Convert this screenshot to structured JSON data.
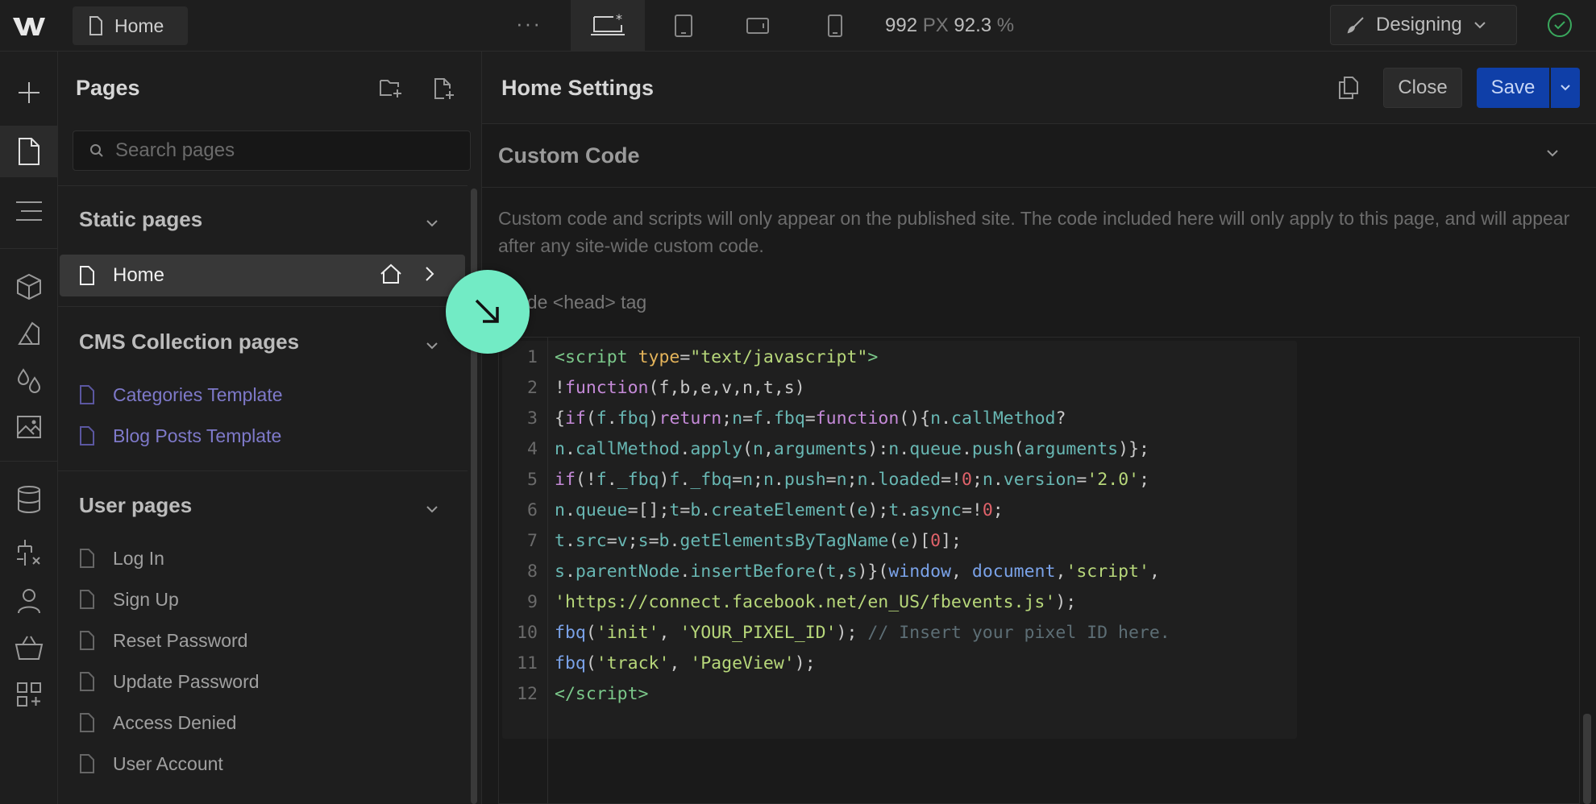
{
  "topbar": {
    "tab_label": "Home",
    "more": "···",
    "canvas_width": "992",
    "canvas_width_unit": "PX",
    "zoom": "92.3",
    "zoom_unit": "%",
    "mode_label": "Designing"
  },
  "pages_panel": {
    "title": "Pages",
    "search_placeholder": "Search pages",
    "static_title": "Static pages",
    "home_label": "Home",
    "cms_title": "CMS Collection pages",
    "cms_items": [
      "Categories Template",
      "Blog Posts Template"
    ],
    "user_title": "User pages",
    "user_items": [
      "Log In",
      "Sign Up",
      "Reset Password",
      "Update Password",
      "Access Denied",
      "User Account"
    ]
  },
  "settings": {
    "title": "Home Settings",
    "close_label": "Close",
    "save_label": "Save",
    "section_title": "Custom Code",
    "description": "Custom code and scripts will only appear on the published site. The code included here will only apply to this page, and will appear after any site-wide custom code.",
    "head_label": "Inside <head> tag",
    "code_lines": [
      {
        "n": "1",
        "html": "<span style=\"color:#7bc88a\">&lt;script</span> <span style=\"color:#e3b35a\">type</span>=<span style=\"color:#b7d77a\">\"text/javascript\"</span><span style=\"color:#7bc88a\">&gt;</span>"
      },
      {
        "n": "2",
        "html": "!<span style=\"color:#c58ad8\">function</span>(f,b,e,v,n,t,s)"
      },
      {
        "n": "3",
        "html": "{<span style=\"color:#c58ad8\">if</span>(<span style=\"color:#68b7b3\">f</span>.<span style=\"color:#68b7b3\">fbq</span>)<span style=\"color:#c58ad8\">return</span>;<span style=\"color:#68b7b3\">n</span>=<span style=\"color:#68b7b3\">f</span>.<span style=\"color:#68b7b3\">fbq</span>=<span style=\"color:#c58ad8\">function</span>(){<span style=\"color:#68b7b3\">n</span>.<span style=\"color:#68b7b3\">callMethod</span>?"
      },
      {
        "n": "4",
        "html": "<span style=\"color:#68b7b3\">n</span>.<span style=\"color:#68b7b3\">callMethod</span>.<span style=\"color:#68b7b3\">apply</span>(<span style=\"color:#68b7b3\">n</span>,<span style=\"color:#68b7b3\">arguments</span>):<span style=\"color:#68b7b3\">n</span>.<span style=\"color:#68b7b3\">queue</span>.<span style=\"color:#68b7b3\">push</span>(<span style=\"color:#68b7b3\">arguments</span>)};"
      },
      {
        "n": "5",
        "html": "<span style=\"color:#c58ad8\">if</span>(!<span style=\"color:#68b7b3\">f</span>.<span style=\"color:#68b7b3\">_fbq</span>)<span style=\"color:#68b7b3\">f</span>.<span style=\"color:#68b7b3\">_fbq</span>=<span style=\"color:#68b7b3\">n</span>;<span style=\"color:#68b7b3\">n</span>.<span style=\"color:#68b7b3\">push</span>=<span style=\"color:#68b7b3\">n</span>;<span style=\"color:#68b7b3\">n</span>.<span style=\"color:#68b7b3\">loaded</span>=!<span style=\"color:#e0626a\">0</span>;<span style=\"color:#68b7b3\">n</span>.<span style=\"color:#68b7b3\">version</span>=<span style=\"color:#b7d77a\">'2.0'</span>;"
      },
      {
        "n": "6",
        "html": "<span style=\"color:#68b7b3\">n</span>.<span style=\"color:#68b7b3\">queue</span>=[];<span style=\"color:#68b7b3\">t</span>=<span style=\"color:#68b7b3\">b</span>.<span style=\"color:#68b7b3\">createElement</span>(<span style=\"color:#68b7b3\">e</span>);<span style=\"color:#68b7b3\">t</span>.<span style=\"color:#68b7b3\">async</span>=!<span style=\"color:#e0626a\">0</span>;"
      },
      {
        "n": "7",
        "html": "<span style=\"color:#68b7b3\">t</span>.<span style=\"color:#68b7b3\">src</span>=<span style=\"color:#68b7b3\">v</span>;<span style=\"color:#68b7b3\">s</span>=<span style=\"color:#68b7b3\">b</span>.<span style=\"color:#68b7b3\">getElementsByTagName</span>(<span style=\"color:#68b7b3\">e</span>)[<span style=\"color:#e0626a\">0</span>];"
      },
      {
        "n": "8",
        "html": "<span style=\"color:#68b7b3\">s</span>.<span style=\"color:#68b7b3\">parentNode</span>.<span style=\"color:#68b7b3\">insertBefore</span>(<span style=\"color:#68b7b3\">t</span>,<span style=\"color:#68b7b3\">s</span>)}(<span style=\"color:#7aa2e8\">window</span>, <span style=\"color:#7aa2e8\">document</span>,<span style=\"color:#b7d77a\">'script'</span>,"
      },
      {
        "n": "9",
        "html": "<span style=\"color:#b7d77a\">'https://connect.facebook.net/en_US/fbevents.js'</span>);"
      },
      {
        "n": "10",
        "html": "<span style=\"color:#7aa2e8\">fbq</span>(<span style=\"color:#b7d77a\">'init'</span>, <span style=\"color:#b7d77a\">'YOUR_PIXEL_ID'</span>); <span style=\"color:#5d6e75\">// Insert your pixel ID here.</span>"
      },
      {
        "n": "11",
        "html": "<span style=\"color:#7aa2e8\">fbq</span>(<span style=\"color:#b7d77a\">'track'</span>, <span style=\"color:#b7d77a\">'PageView'</span>);"
      },
      {
        "n": "12",
        "html": "<span style=\"color:#7bc88a\">&lt;/script&gt;</span>"
      }
    ]
  },
  "colors": {
    "accent_blue": "#0f3fa8",
    "cms_purple": "#7e79c9",
    "cursor_mint": "#72ebc5",
    "status_green": "#3aa85d"
  },
  "icons": {
    "logo": "webflow-logo-icon",
    "add": "plus-icon",
    "pages": "page-icon",
    "navigator": "navigator-icon",
    "components": "cube-icon",
    "style": "style-icon",
    "variables": "drops-icon",
    "assets": "image-icon",
    "cms": "database-icon",
    "logic": "logic-icon",
    "users": "user-icon",
    "ecommerce": "basket-icon",
    "apps": "apps-icon"
  }
}
